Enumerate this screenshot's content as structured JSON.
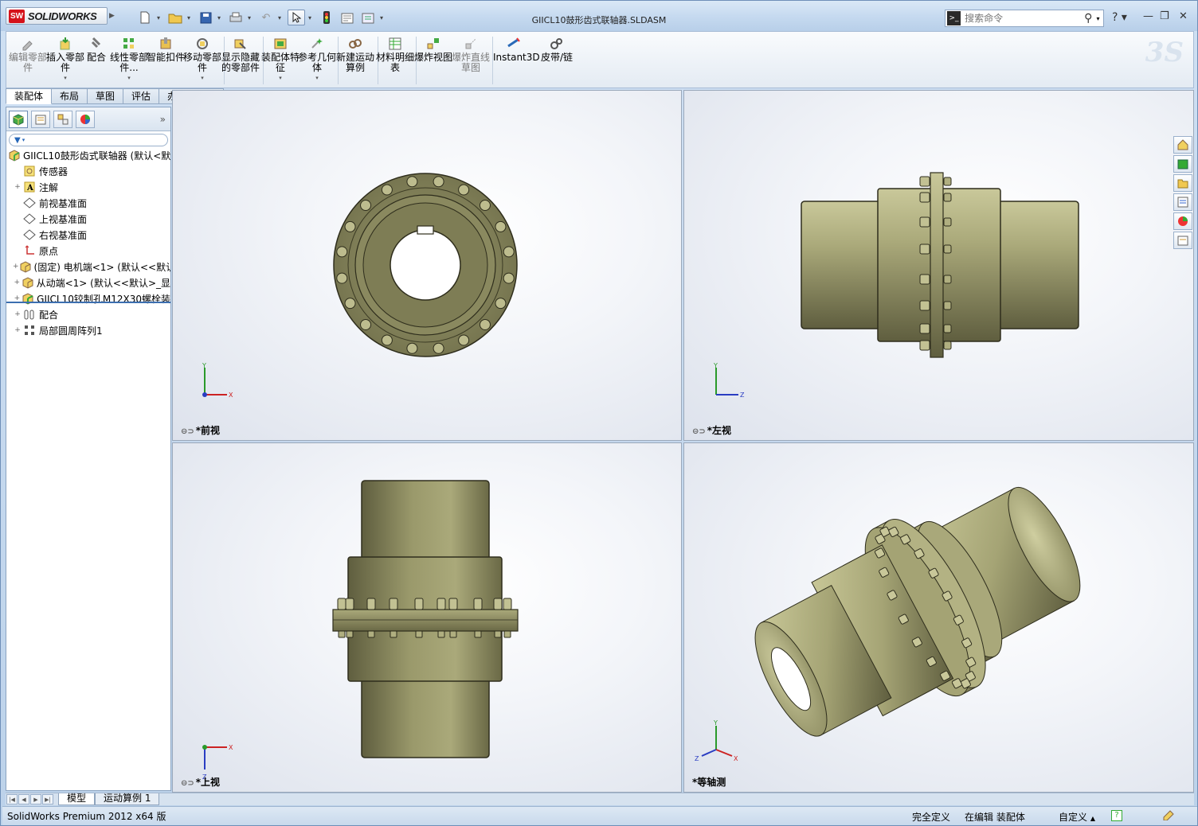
{
  "app": {
    "logo_text": "SOLIDWORKS",
    "logo_badge": "SW"
  },
  "title": "GIICL10鼓形齿式联轴器.SLDASM",
  "search": {
    "placeholder": "搜索命令",
    "cmd_badge": ">_"
  },
  "ribbon": {
    "buttons": [
      {
        "label": "编辑零部件",
        "disabled": true
      },
      {
        "label": "插入零部件",
        "disabled": false
      },
      {
        "label": "配合",
        "disabled": false
      },
      {
        "label": "线性零部件...",
        "disabled": false
      },
      {
        "label": "智能扣件",
        "disabled": false
      },
      {
        "label": "移动零部件",
        "disabled": false
      },
      {
        "label": "显示隐藏的零部件",
        "disabled": false
      },
      {
        "label": "装配体特征",
        "disabled": false
      },
      {
        "label": "参考几何体",
        "disabled": false
      },
      {
        "label": "新建运动算例",
        "disabled": false
      },
      {
        "label": "材料明细表",
        "disabled": false
      },
      {
        "label": "爆炸视图",
        "disabled": false
      },
      {
        "label": "爆炸直线草图",
        "disabled": true
      },
      {
        "label": "Instant3D",
        "disabled": false
      },
      {
        "label": "皮带/链",
        "disabled": false
      }
    ]
  },
  "tabs": [
    "装配体",
    "布局",
    "草图",
    "评估",
    "办公室产品"
  ],
  "tree": {
    "root": "GIICL10鼓形齿式联轴器  (默认<默",
    "items": [
      {
        "label": "传感器",
        "expand": "",
        "icon": "sensor-icon"
      },
      {
        "label": "注解",
        "expand": "+",
        "icon": "annotation-icon"
      },
      {
        "label": "前视基准面",
        "expand": "",
        "icon": "plane-icon"
      },
      {
        "label": "上视基准面",
        "expand": "",
        "icon": "plane-icon"
      },
      {
        "label": "右视基准面",
        "expand": "",
        "icon": "plane-icon"
      },
      {
        "label": "原点",
        "expand": "",
        "icon": "origin-icon"
      },
      {
        "label": "(固定) 电机端<1> (默认<<默认",
        "expand": "+",
        "icon": "part-icon"
      },
      {
        "label": "从动端<1> (默认<<默认>_显",
        "expand": "+",
        "icon": "part-icon"
      },
      {
        "label": "GIICL10铰制孔M12X30螺栓装",
        "expand": "+",
        "icon": "subassembly-icon"
      },
      {
        "label": "配合",
        "expand": "+",
        "icon": "mates-icon"
      },
      {
        "label": "局部圆周阵列1",
        "expand": "+",
        "icon": "pattern-icon"
      }
    ]
  },
  "viewports": {
    "front": "*前视",
    "left": "*左视",
    "top": "*上视",
    "iso": "*等轴测"
  },
  "axes": {
    "x": "X",
    "y": "Y",
    "z": "Z"
  },
  "bottom_tabs": [
    "模型",
    "运动算例 1"
  ],
  "status": {
    "product": "SolidWorks Premium 2012 x64 版",
    "definition": "完全定义",
    "mode": "在编辑 装配体",
    "units": "自定义",
    "help_icon": "?"
  },
  "colors": {
    "part": "#8b8a61",
    "part_light": "#c9c89a",
    "part_dark": "#5f5e3f",
    "accent": "#d5121b"
  }
}
